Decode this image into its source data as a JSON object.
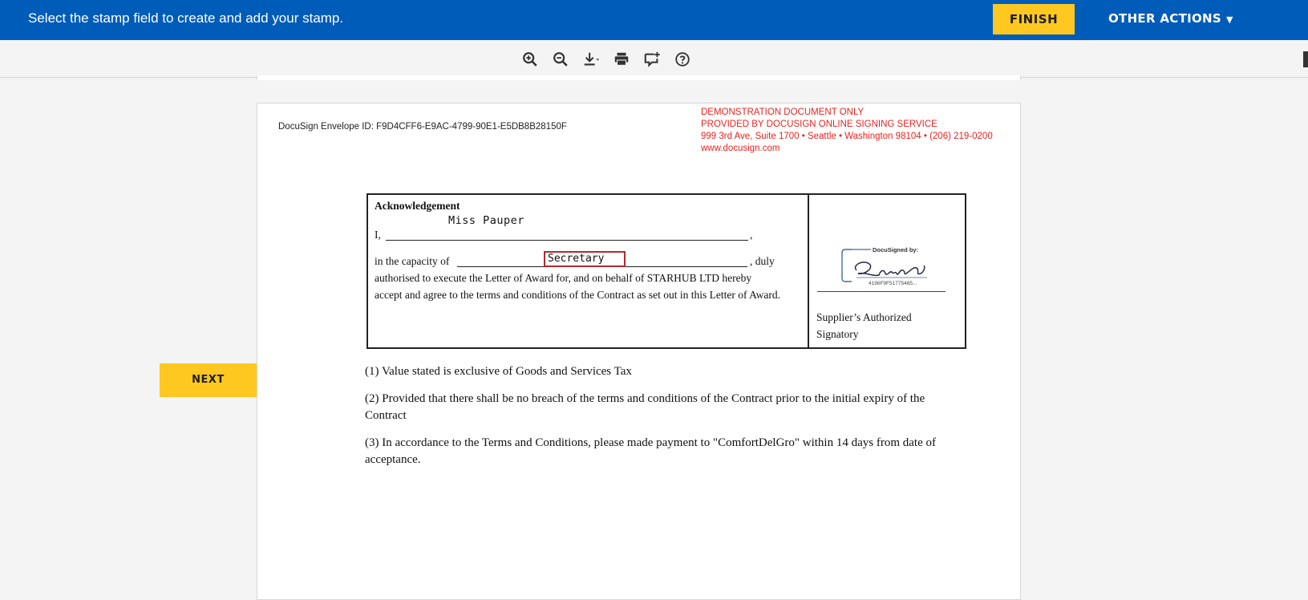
{
  "topbar": {
    "message": "Select the stamp field to create and add your stamp.",
    "finish_label": "FINISH",
    "other_actions_label": "OTHER ACTIONS",
    "caret": "▼"
  },
  "toolbar": {
    "tools": [
      "zoom-in-icon",
      "zoom-out-icon",
      "download-icon",
      "print-icon",
      "add-comment-icon",
      "help-icon"
    ]
  },
  "document": {
    "envelope_id": "DocuSign Envelope ID: F9D4CFF6-E9AC-4799-90E1-E5DB8B28150F",
    "demo_lines": [
      "DEMONSTRATION DOCUMENT ONLY",
      "PROVIDED BY DOCUSIGN ONLINE SIGNING SERVICE",
      "999 3rd Ave, Suite 1700  • Seattle • Washington 98104 • (206) 219-0200",
      "www.docusign.com"
    ],
    "ack": {
      "title": "Acknowledgement",
      "name_value": "Miss Pauper",
      "i_label": "I,",
      "comma": ",",
      "capacity_label": "in the capacity of",
      "capacity_value": "Secretary",
      "duly": ", duly",
      "line2": "authorised to execute the Letter of Award for, and on behalf of STARHUB LTD  hereby",
      "line3": "accept and agree to the terms and conditions of the Contract as set out in this Letter of Award.",
      "docusigned_by": "DocuSigned by:",
      "signature_id": "4196F9F51775485...",
      "supplier_label_1": "Supplier’s Authorized",
      "supplier_label_2": "Signatory"
    },
    "notes": [
      "(1) Value stated is exclusive of Goods and Services Tax",
      "(2) Provided that there shall be no breach of the terms and conditions of the Contract prior to the initial expiry of the Contract",
      "(3) In accordance to the Terms and Conditions, please made payment to \"ComfortDelGro\" within 14 days from date of acceptance."
    ]
  },
  "nav": {
    "next_label": "NEXT"
  },
  "colors": {
    "topbar": "#005cb9",
    "accent": "#ffc820",
    "demo_text": "#e8231f",
    "field_border": "#b02a30"
  }
}
